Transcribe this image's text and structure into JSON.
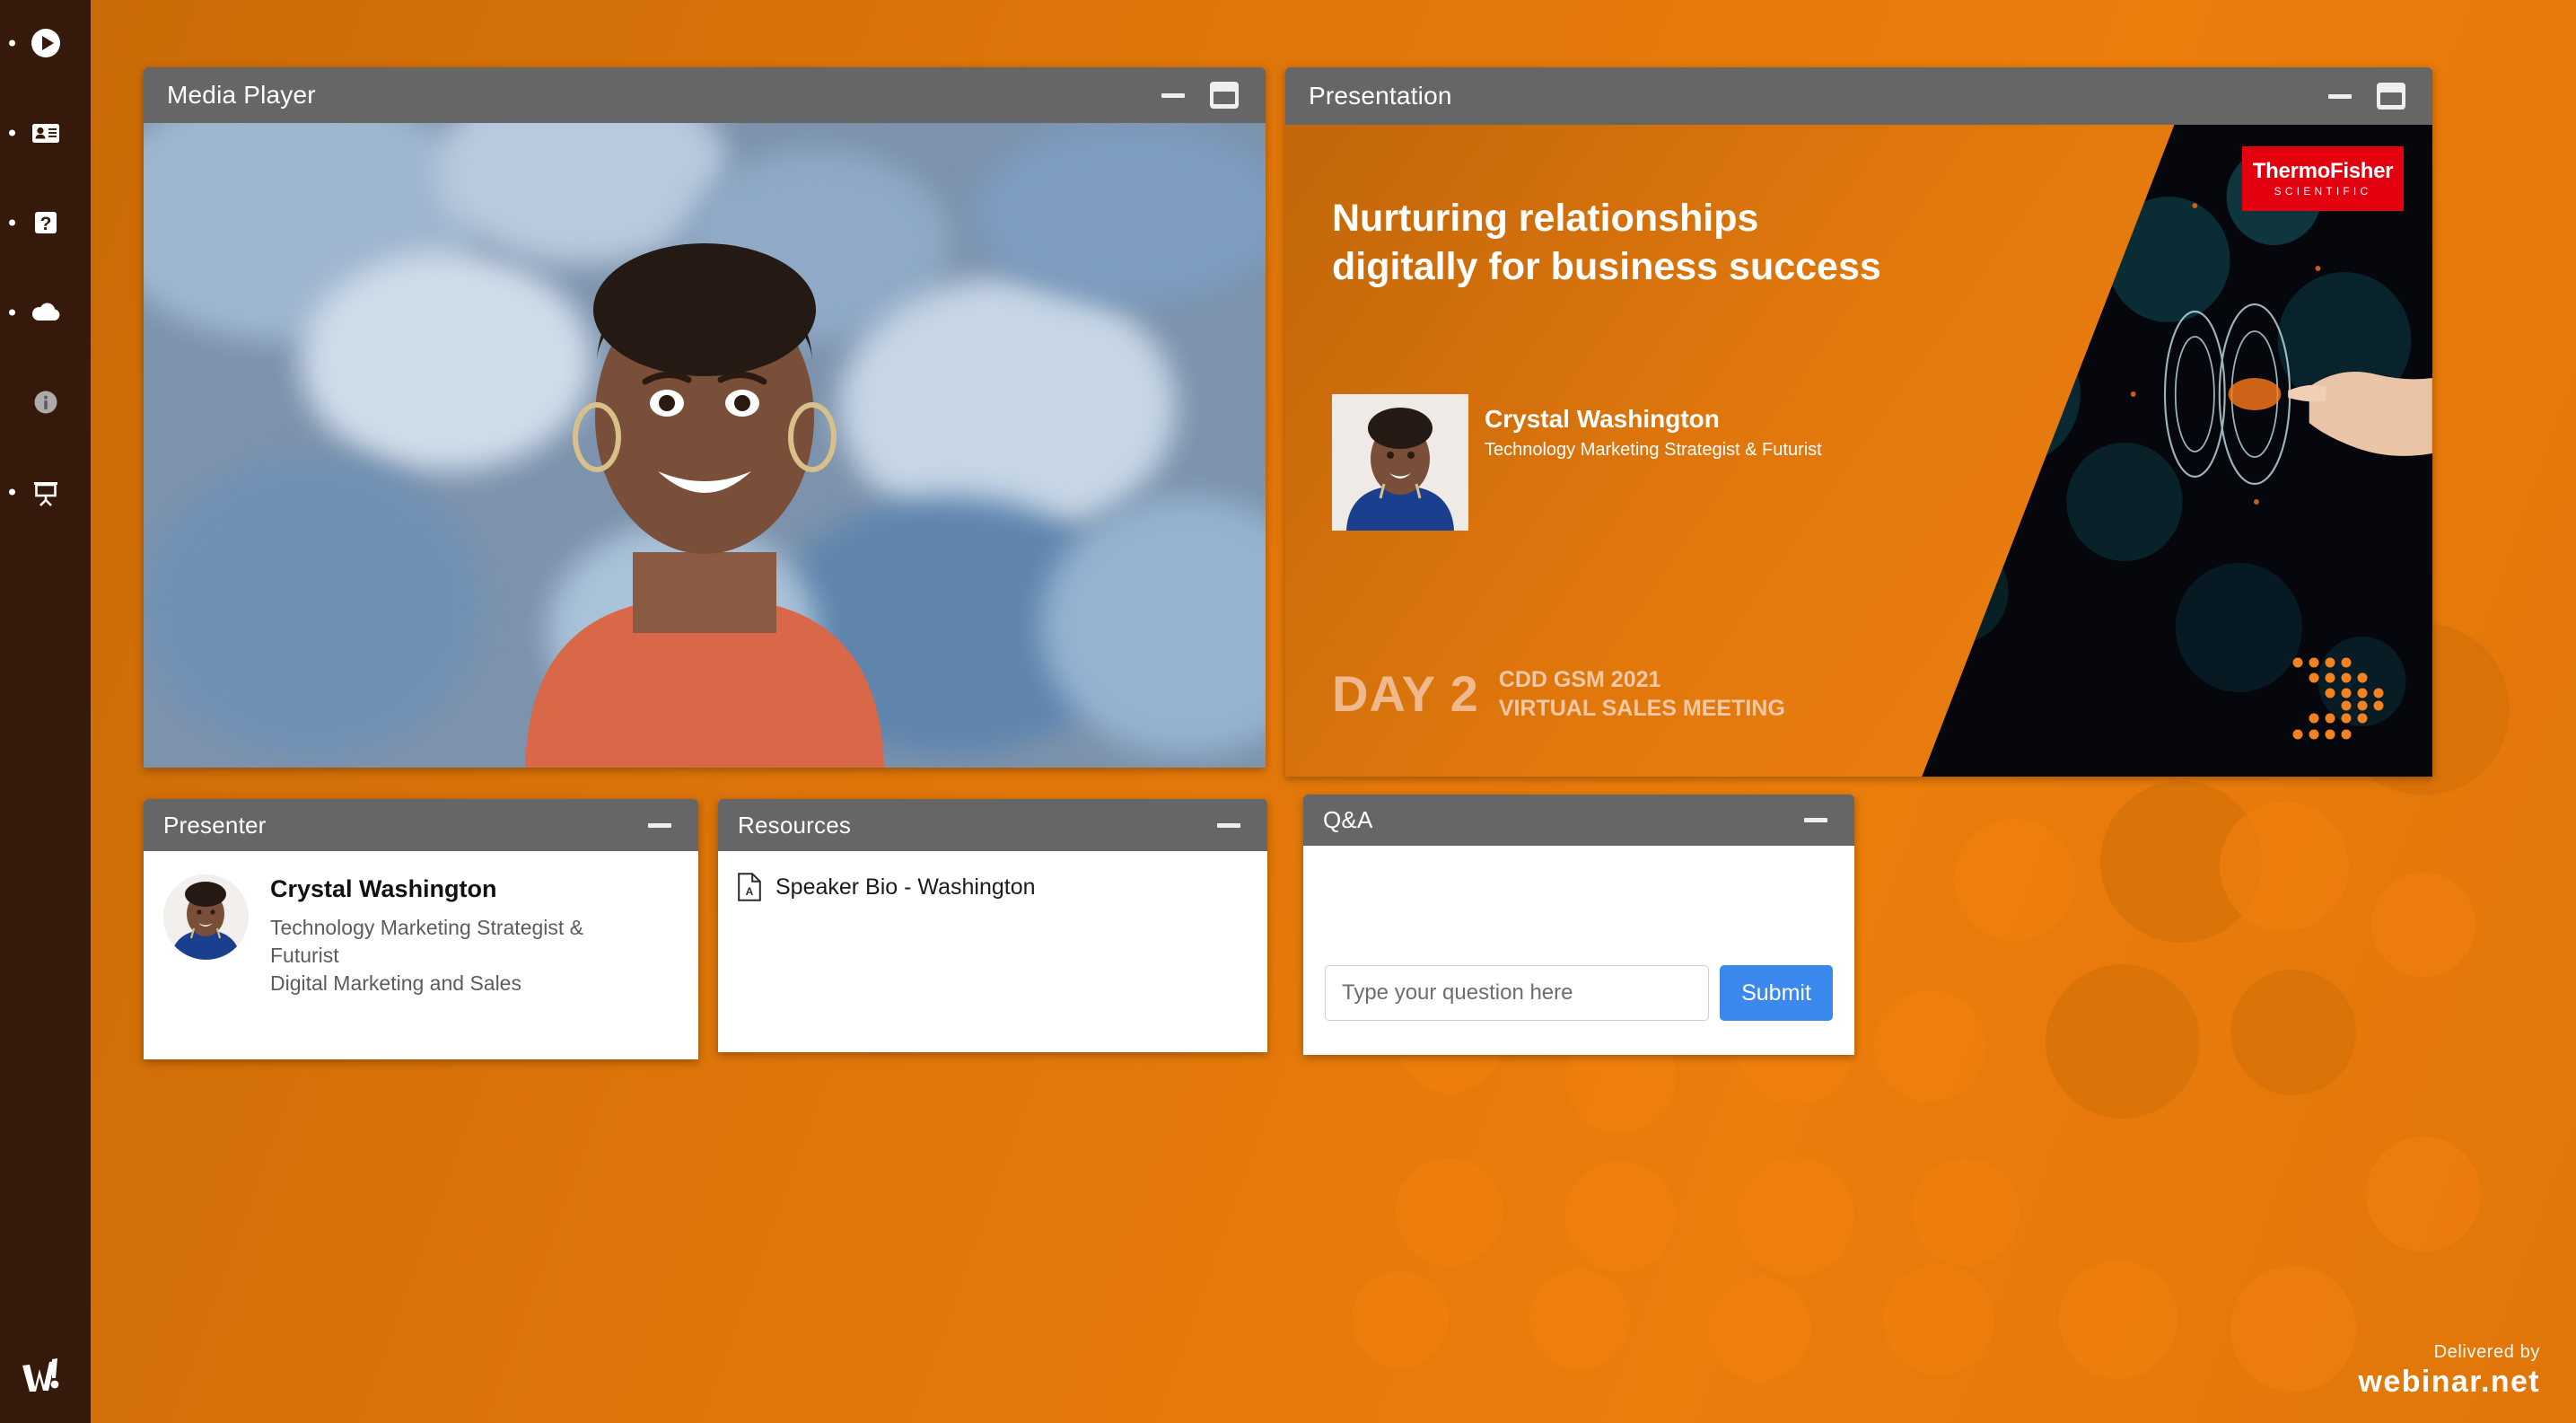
{
  "sidebar": {
    "items": [
      {
        "name": "media-player",
        "icon": "play-circle-icon",
        "active": true
      },
      {
        "name": "presenter",
        "icon": "id-card-icon",
        "active": true
      },
      {
        "name": "qa",
        "icon": "question-mark-icon",
        "active": true
      },
      {
        "name": "resources",
        "icon": "cloud-icon",
        "active": true
      },
      {
        "name": "info",
        "icon": "info-circle-icon",
        "active": false
      },
      {
        "name": "presentation",
        "icon": "presentation-screen-icon",
        "active": true
      }
    ],
    "logo": "webinar-w-logo"
  },
  "media_player": {
    "title": "Media Player",
    "minimize_icon": "minimize-icon",
    "maximize_icon": "maximize-window-icon"
  },
  "presentation": {
    "title": "Presentation",
    "minimize_icon": "minimize-icon",
    "maximize_icon": "maximize-window-icon",
    "slide": {
      "title": "Nurturing relationships digitally for business success",
      "speaker_name": "Crystal Washington",
      "speaker_role": "Technology Marketing Strategist & Futurist",
      "day_label": "DAY 2",
      "event_line_1": "CDD GSM 2021",
      "event_line_2": "VIRTUAL SALES MEETING",
      "year_graphic": "2021",
      "logo_line_1": "ThermoFisher",
      "logo_line_2": "SCIENTIFIC",
      "logo_color": "#E3000F"
    }
  },
  "presenter": {
    "title": "Presenter",
    "minimize_icon": "minimize-icon",
    "name": "Crystal Washington",
    "role_line_1": "Technology Marketing Strategist &",
    "role_line_2": "Futurist",
    "department": "Digital Marketing and Sales",
    "avatar": "presenter-avatar"
  },
  "resources": {
    "title": "Resources",
    "minimize_icon": "minimize-icon",
    "items": [
      {
        "label": "Speaker Bio - Washington",
        "icon": "pdf-file-icon"
      }
    ]
  },
  "qa": {
    "title": "Q&A",
    "minimize_icon": "minimize-icon",
    "input_placeholder": "Type your question here",
    "input_value": "",
    "submit_label": "Submit",
    "submit_color": "#3B88EE"
  },
  "branding": {
    "delivered_by": "Delivered by",
    "platform": "webinar.net"
  },
  "theme": {
    "background_orange": "#DE7509",
    "sidebar_brown": "#351A0C",
    "panel_header_grey": "#666666",
    "panel_body_white": "#FFFFFF"
  }
}
